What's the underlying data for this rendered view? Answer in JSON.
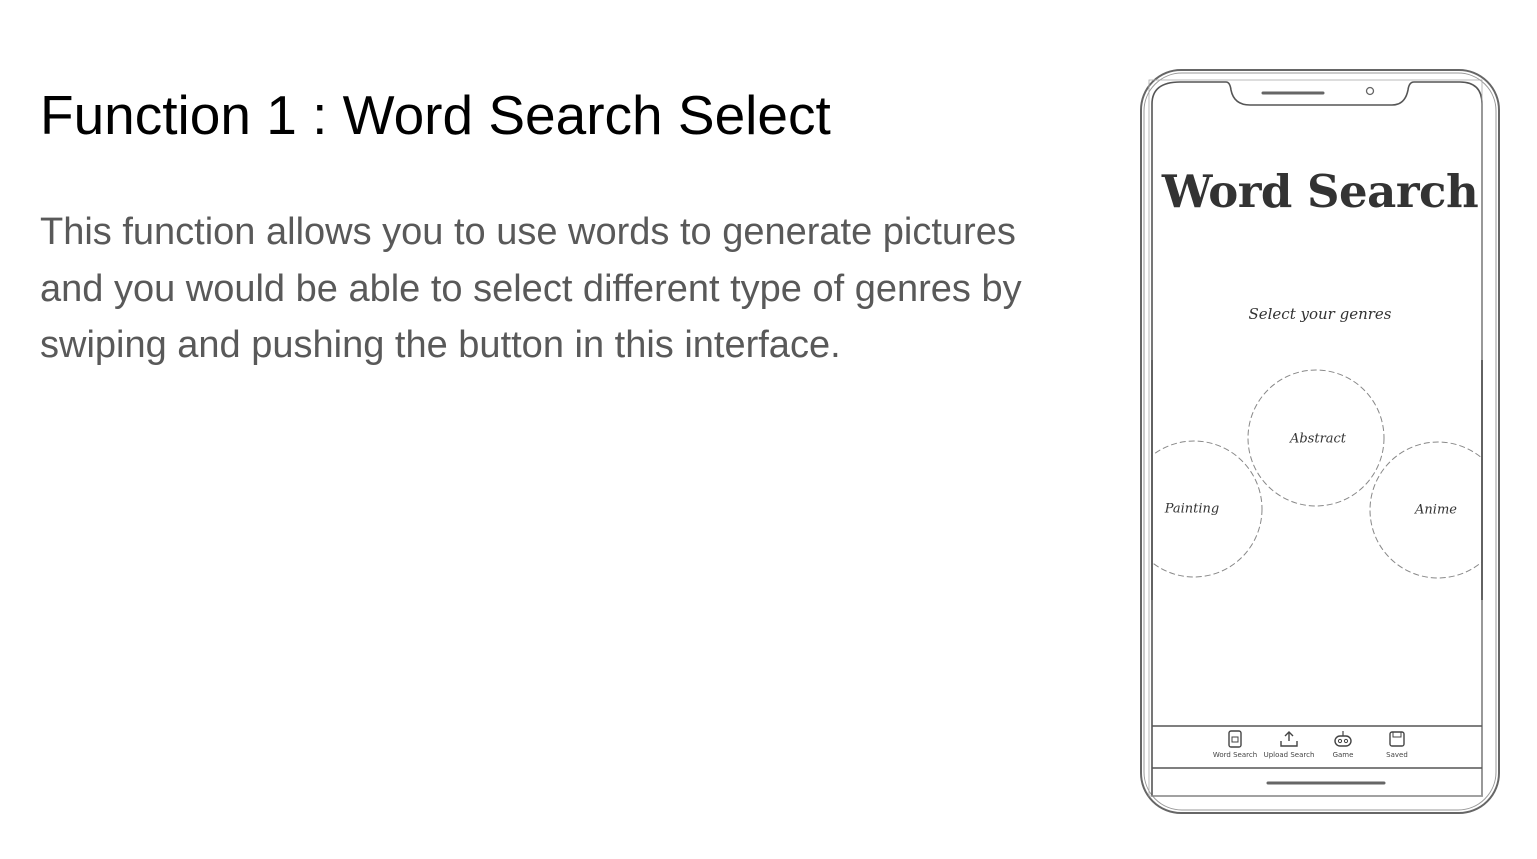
{
  "slide": {
    "title": "Function 1 : Word Search Select",
    "body": "This function allows you to use words to generate pictures and you would be able to select different type of genres by swiping and pushing the button in this interface."
  },
  "mockup": {
    "app_title": "Word Search",
    "subtitle": "Select your genres",
    "genres": {
      "center": "Abstract",
      "left": "Painting",
      "right": "Anime"
    },
    "nav": [
      {
        "label": "Word Search",
        "icon": "document-icon"
      },
      {
        "label": "Upload Search",
        "icon": "upload-icon"
      },
      {
        "label": "Game",
        "icon": "gamepad-icon"
      },
      {
        "label": "Saved",
        "icon": "save-icon"
      }
    ]
  },
  "colors": {
    "title_text": "#000000",
    "body_text": "#595959",
    "sketch_stroke": "#555555"
  }
}
